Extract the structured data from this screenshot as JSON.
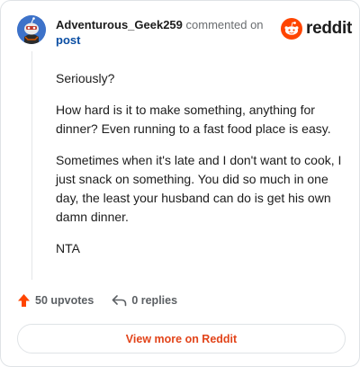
{
  "header": {
    "author": "Adventurous_Geek259",
    "action_text": "commented on",
    "link_text": "post",
    "brand": "reddit"
  },
  "comment": {
    "paragraphs": [
      "Seriously?",
      "How hard is it to make something, anything for dinner? Even running to a fast food place is easy.",
      "Sometimes when it's late and I don't want to cook, I just snack on something. You did so much in one day, the least your husband can do is get his own damn dinner.",
      "NTA"
    ]
  },
  "footer": {
    "upvotes_label": "50 upvotes",
    "replies_label": "0 replies",
    "view_more_label": "View more on Reddit"
  },
  "colors": {
    "upvote_arrow": "#ff4500",
    "brand_orange": "#ff4500",
    "link_blue": "#0a4ea3",
    "view_more_text": "#e2441a"
  },
  "icons": {
    "avatar": "snoo-avatar-icon",
    "logo": "reddit-logo-icon",
    "upvote": "upvote-arrow-icon",
    "reply": "reply-arrow-icon"
  }
}
